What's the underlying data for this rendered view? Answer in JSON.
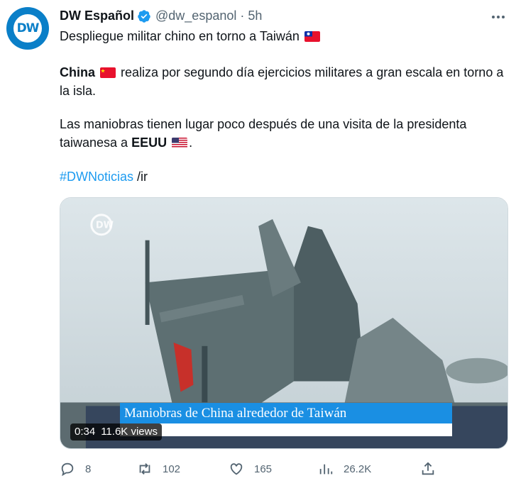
{
  "author": {
    "name": "DW Español",
    "handle": "@dw_espanol",
    "time": "5h",
    "avatar_text": "DW"
  },
  "tweet": {
    "line1": "Despliegue militar chino en torno a Taiwán",
    "p1_bold": "China",
    "p1_rest": "realiza por segundo día ejercicios militares a gran escala en torno a la isla.",
    "p2_start": "Las maniobras tienen lugar poco después de una visita de la presidenta taiwanesa a",
    "p2_bold": "EEUU",
    "p2_end": ".",
    "hashtag": "#DWNoticias",
    "suffix": "/ir"
  },
  "media": {
    "banner": "Maniobras de China alrededor de Taiwán",
    "duration": "0:34",
    "views": "11.6K views",
    "watermark": "DW"
  },
  "actions": {
    "replies": "8",
    "retweets": "102",
    "likes": "165",
    "views": "26.2K"
  },
  "colors": {
    "link": "#1d9bf0",
    "brand": "#0a7fc8",
    "muted": "#536471",
    "banner": "#1a8fe3"
  },
  "icons": [
    "verified-badge-icon",
    "more-icon",
    "reply-icon",
    "retweet-icon",
    "like-icon",
    "analytics-icon",
    "share-icon",
    "taiwan-flag-icon",
    "china-flag-icon",
    "usa-flag-icon"
  ]
}
